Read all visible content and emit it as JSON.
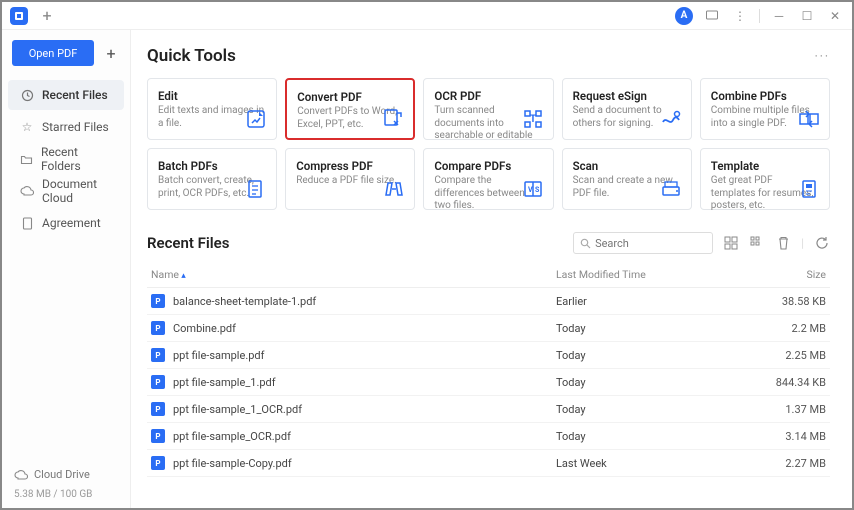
{
  "titlebar": {
    "avatar_initial": "A"
  },
  "sidebar": {
    "open_label": "Open PDF",
    "items": [
      {
        "label": "Recent Files"
      },
      {
        "label": "Starred Files"
      },
      {
        "label": "Recent Folders"
      },
      {
        "label": "Document Cloud"
      },
      {
        "label": "Agreement"
      }
    ],
    "cloud_label": "Cloud Drive",
    "quota": "5.38 MB / 100 GB"
  },
  "quick": {
    "title": "Quick Tools",
    "cards": [
      {
        "title": "Edit",
        "desc": "Edit texts and images in a file."
      },
      {
        "title": "Convert PDF",
        "desc": "Convert PDFs to Word, Excel, PPT, etc."
      },
      {
        "title": "OCR PDF",
        "desc": "Turn scanned documents into searchable or editable ..."
      },
      {
        "title": "Request eSign",
        "desc": "Send a document to others for signing."
      },
      {
        "title": "Combine PDFs",
        "desc": "Combine multiple files into a single PDF."
      },
      {
        "title": "Batch PDFs",
        "desc": "Batch convert, create, print, OCR PDFs, etc."
      },
      {
        "title": "Compress PDF",
        "desc": "Reduce a PDF file size."
      },
      {
        "title": "Compare PDFs",
        "desc": "Compare the differences between two files."
      },
      {
        "title": "Scan",
        "desc": "Scan and create a new PDF file."
      },
      {
        "title": "Template",
        "desc": "Get great PDF templates for resumes, posters, etc."
      }
    ]
  },
  "recent": {
    "title": "Recent Files",
    "search_placeholder": "Search",
    "col_name": "Name",
    "col_mod": "Last Modified Time",
    "col_size": "Size",
    "rows": [
      {
        "name": "balance-sheet-template-1.pdf",
        "mod": "Earlier",
        "size": "38.58 KB"
      },
      {
        "name": "Combine.pdf",
        "mod": "Today",
        "size": "2.2 MB"
      },
      {
        "name": "ppt file-sample.pdf",
        "mod": "Today",
        "size": "2.25 MB"
      },
      {
        "name": "ppt file-sample_1.pdf",
        "mod": "Today",
        "size": "844.34 KB"
      },
      {
        "name": "ppt file-sample_1_OCR.pdf",
        "mod": "Today",
        "size": "1.37 MB"
      },
      {
        "name": "ppt file-sample_OCR.pdf",
        "mod": "Today",
        "size": "3.14 MB"
      },
      {
        "name": "ppt file-sample-Copy.pdf",
        "mod": "Last Week",
        "size": "2.27 MB"
      }
    ]
  }
}
